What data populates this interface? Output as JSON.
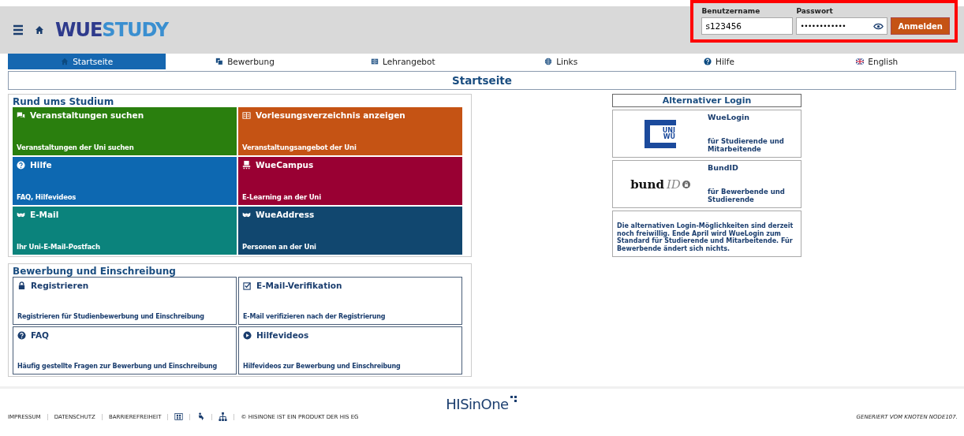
{
  "header": {
    "logo": {
      "part1": "WUE",
      "part2": "STUDY"
    },
    "login": {
      "username_label": "Benutzername",
      "username_value": "s123456",
      "password_label": "Passwort",
      "password_value": "••••••••••••",
      "submit": "Anmelden"
    }
  },
  "nav": [
    {
      "label": "Startseite",
      "selected": true
    },
    {
      "label": "Bewerbung",
      "selected": false
    },
    {
      "label": "Lehrangebot",
      "selected": false
    },
    {
      "label": "Links",
      "selected": false
    },
    {
      "label": "Hilfe",
      "selected": false
    },
    {
      "label": "English",
      "selected": false
    }
  ],
  "page_title": "Startseite",
  "sections": [
    {
      "title": "Rund ums Studium",
      "kind": "filled",
      "tiles": [
        {
          "title": "Veranstaltungen suchen",
          "subtitle": "Veranstaltungen der Uni suchen",
          "color": "#2a7f0e"
        },
        {
          "title": "Vorlesungsverzeichnis anzeigen",
          "subtitle": "Veranstaltungsangebot der Uni",
          "color": "#c55314"
        },
        {
          "title": "Hilfe",
          "subtitle": "FAQ, Hilfevideos",
          "color": "#0d68b1"
        },
        {
          "title": "WueCampus",
          "subtitle": "E-Learning an der Uni",
          "color": "#990033"
        },
        {
          "title": "E-Mail",
          "subtitle": "Ihr Uni-E-Mail-Postfach",
          "color": "#0b837c"
        },
        {
          "title": "WueAddress",
          "subtitle": "Personen an der Uni",
          "color": "#11476f"
        }
      ]
    },
    {
      "title": "Bewerbung und Einschreibung",
      "kind": "outline",
      "tiles": [
        {
          "title": "Registrieren",
          "subtitle": "Registrieren für Studienbewerbung und Einschreibung"
        },
        {
          "title": "E-Mail-Verifikation",
          "subtitle": "E-Mail verifizieren nach der Registrierung"
        },
        {
          "title": "FAQ",
          "subtitle": "Häufig gestellte Fragen zur Bewerbung und Einschreibung"
        },
        {
          "title": "Hilfevideos",
          "subtitle": "Hilfevideos zur Bewerbung und Einschreibung"
        }
      ]
    }
  ],
  "alt_login": {
    "title": "Alternativer Login",
    "options": [
      {
        "logo_text": "UNI WÜ",
        "name": "WueLogin",
        "description": "für Studierende und Mitarbeitende"
      },
      {
        "logo_text": "bund",
        "logo_text2": "ID",
        "name": "BundID",
        "description": "für Bewerbende und Studierende"
      }
    ],
    "note": "Die alternativen Login-Möglichkeiten sind derzeit noch freiwillig. Ende April wird WueLogin zum Standard für Studierende und Mitarbeitende. Für Bewerbende ändert sich nichts."
  },
  "footer": {
    "brand": "HISinOne",
    "links": [
      "IMPRESSUM",
      "DATENSCHUTZ",
      "BARRIEREFREIHEIT"
    ],
    "copyright": "© HISINONE IST EIN PRODUKT DER HIS EG",
    "node": "GENERIERT VOM KNOTEN NODE107."
  }
}
